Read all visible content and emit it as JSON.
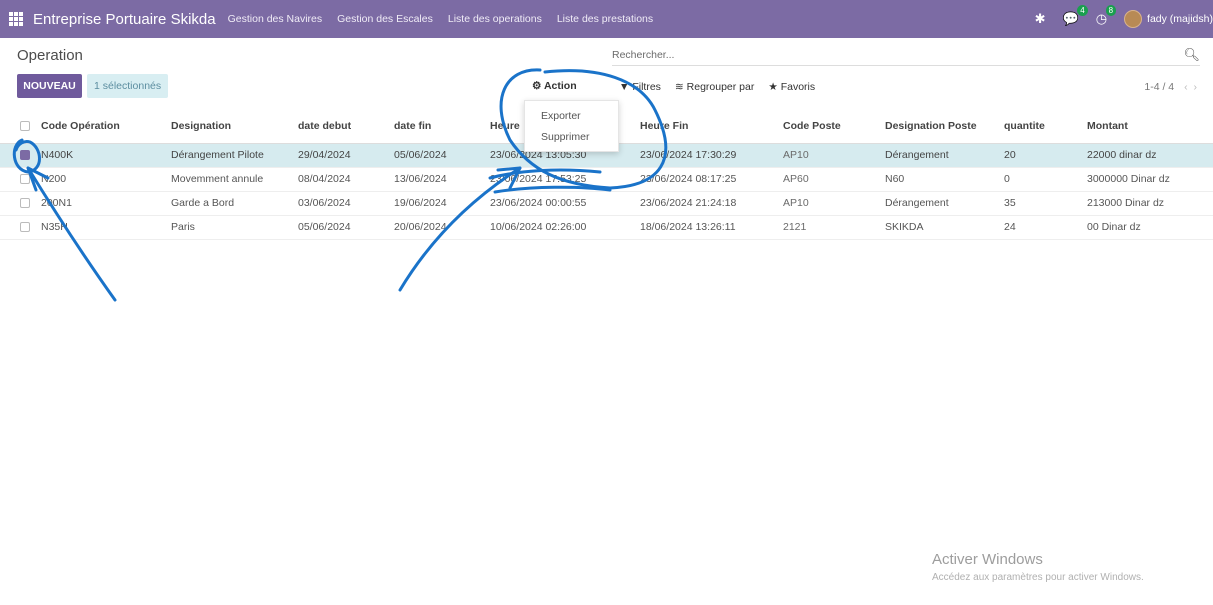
{
  "topbar": {
    "brand": "Entreprise Portuaire Skikda",
    "menu": [
      "Gestion des Navires",
      "Gestion des Escales",
      "Liste des operations",
      "Liste des prestations"
    ],
    "chat_count": "4",
    "activity_count": "8",
    "user": "fady (majidsh)"
  },
  "page": {
    "title": "Operation"
  },
  "search": {
    "placeholder": "Rechercher..."
  },
  "toolbar": {
    "new_label": "NOUVEAU",
    "selected_label": "1 sélectionnés",
    "action_label": "Action",
    "filters_label": "Filtres",
    "groupby_label": "Regrouper par",
    "favorites_label": "Favoris",
    "pager": "1-4 / 4"
  },
  "action_menu": {
    "items": [
      "Exporter",
      "Supprimer"
    ]
  },
  "table": {
    "columns": [
      "Code Opération",
      "Designation",
      "date debut",
      "date fin",
      "Heure",
      "Heure Fin",
      "Code Poste",
      "Designation Poste",
      "quantite",
      "Montant"
    ],
    "rows": [
      [
        "N400K",
        "Dérangement Pilote",
        "29/04/2024",
        "05/06/2024",
        "23/06/2024 13:05:30",
        "23/06/2024 17:30:29",
        "AP10",
        "Dérangement",
        "20",
        "22000 dinar dz"
      ],
      [
        "N200",
        "Movemment annule",
        "08/04/2024",
        "13/06/2024",
        "23/06/2024 17:53:25",
        "23/06/2024 08:17:25",
        "AP60",
        "N60",
        "0",
        "3000000 Dinar dz"
      ],
      [
        "200N1",
        "Garde a Bord",
        "03/06/2024",
        "19/06/2024",
        "23/06/2024 00:00:55",
        "23/06/2024 21:24:18",
        "AP10",
        "Dérangement",
        "35",
        "213000 Dinar dz"
      ],
      [
        "N35H",
        "Paris",
        "05/06/2024",
        "20/06/2024",
        "10/06/2024 02:26:00",
        "18/06/2024 13:26:11",
        "2121",
        "SKIKDA",
        "24",
        "00 Dinar dz"
      ]
    ]
  },
  "watermark": {
    "title": "Activer Windows",
    "subtitle": "Accédez aux paramètres pour activer Windows."
  }
}
